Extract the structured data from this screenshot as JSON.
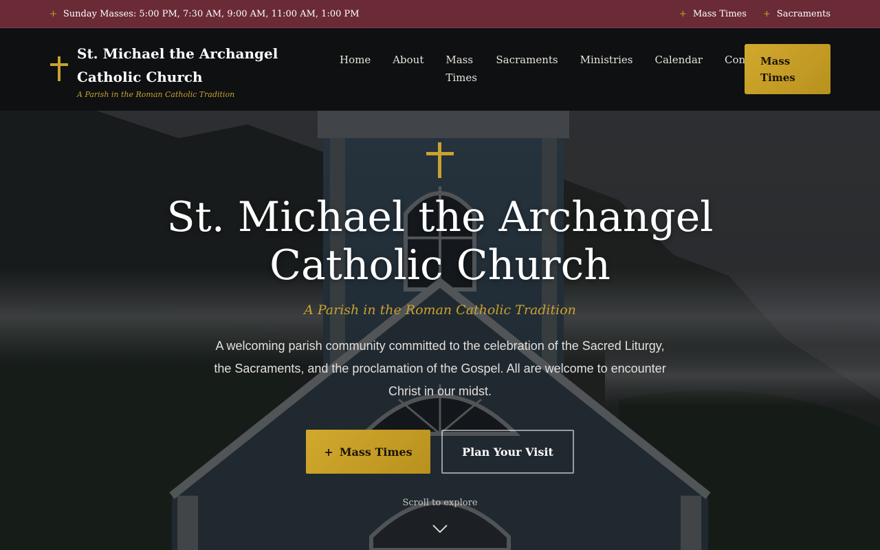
{
  "topbar": {
    "masses": "Sunday Masses: 5:00 PM, 7:30 AM, 9:00 AM, 11:00 AM, 1:00 PM",
    "links": [
      "Mass Times",
      "Sacraments"
    ]
  },
  "header": {
    "name": "St. Michael the Archangel Catholic Church",
    "tagline": "A Parish in the Roman Catholic Tradition",
    "nav": [
      "Home",
      "About",
      "Mass Times",
      "Sacraments",
      "Ministries",
      "Calendar",
      "Contact"
    ],
    "cta": "Mass Times"
  },
  "hero": {
    "title": "St. Michael the Archangel Catholic Church",
    "subtitle": "A Parish in the Roman Catholic Tradition",
    "description": "A welcoming parish community committed to the celebration of the Sacred Liturgy, the Sacraments, and the proclamation of the Gospel. All are welcome to encounter Christ in our midst.",
    "primary_button": "Mass Times",
    "secondary_button": "Plan Your Visit",
    "scroll_hint": "Scroll to explore"
  },
  "colors": {
    "topbar": "#6a2b36",
    "gold": "#c9a230",
    "header": "#0e1012"
  },
  "icons": [
    "cross-icon",
    "plus-icon",
    "chevron-down-icon"
  ]
}
